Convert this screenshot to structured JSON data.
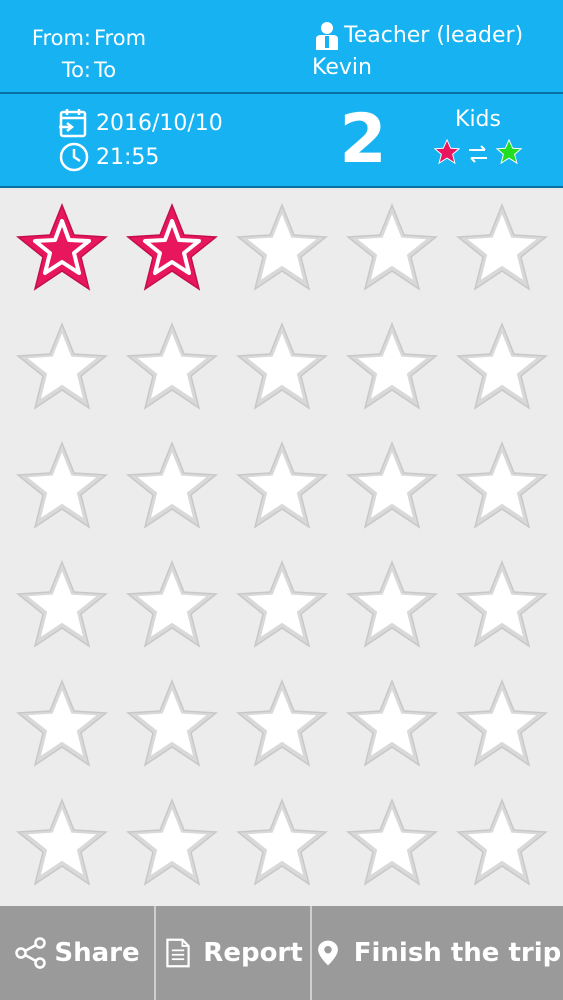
{
  "route": {
    "from_label": "From:",
    "from_value": "From",
    "to_label": "To:",
    "to_value": "To"
  },
  "leader": {
    "role": "Teacher (leader)",
    "name": "Kevin",
    "icon": "person-icon"
  },
  "trip": {
    "date": "2016/10/10",
    "time": "21:55",
    "date_icon": "calendar-icon",
    "time_icon": "clock-icon"
  },
  "counter": {
    "value": "2",
    "label": "Kids"
  },
  "colors": {
    "header": "#16b2f2",
    "star_active": "#e8175d",
    "star_swap_green": "#22dd22",
    "bottom_bar": "#9a9a9a"
  },
  "stars": {
    "total": 30,
    "columns": 5,
    "filled": 2
  },
  "bottom_bar": {
    "share": "Share",
    "report": "Report",
    "finish": "Finish the trip"
  }
}
